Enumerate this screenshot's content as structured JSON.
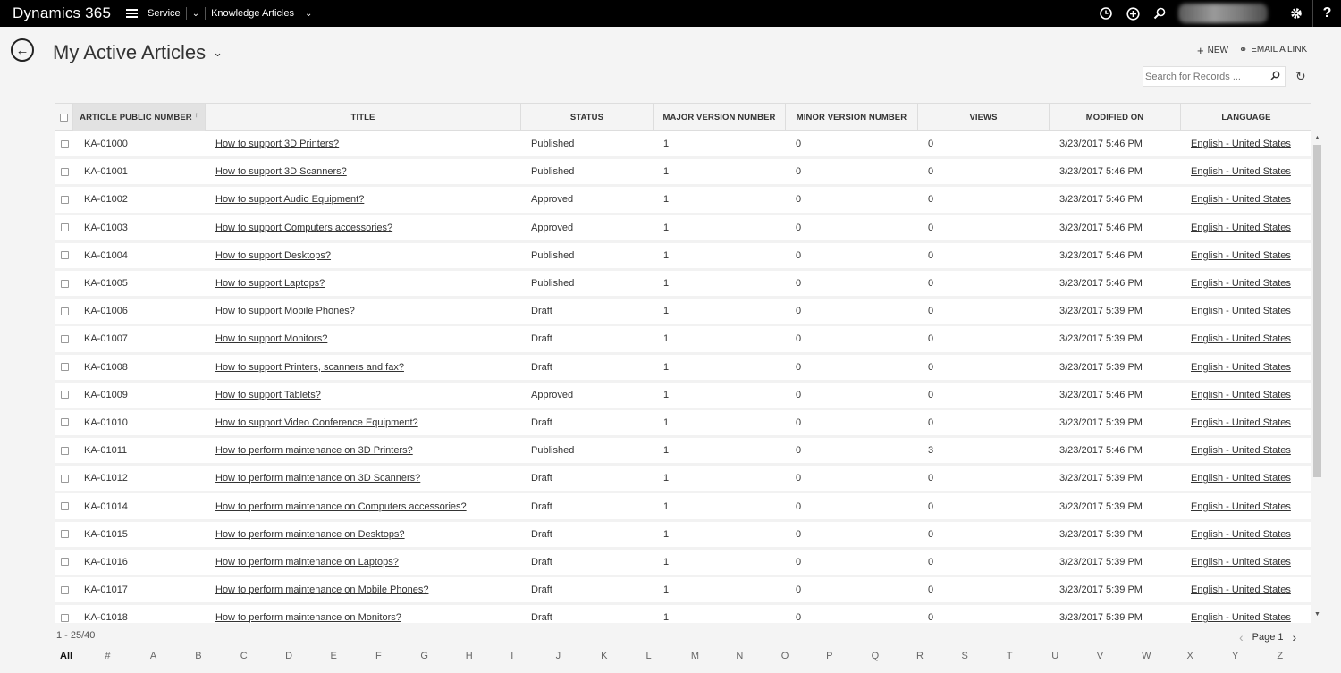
{
  "topbar": {
    "brand": "Dynamics 365",
    "nav": [
      {
        "label": "Service"
      },
      {
        "label": "Knowledge Articles"
      }
    ],
    "icons": [
      "clock-icon",
      "plus-circle-icon",
      "search-icon",
      "gear-icon",
      "help-icon"
    ],
    "help_label": "?"
  },
  "view": {
    "title": "My Active Articles"
  },
  "commands": {
    "new_label": "NEW",
    "email_label": "EMAIL A LINK"
  },
  "search": {
    "placeholder": "Search for Records ..."
  },
  "grid": {
    "columns": [
      "ARTICLE PUBLIC NUMBER",
      "TITLE",
      "STATUS",
      "MAJOR VERSION NUMBER",
      "MINOR VERSION NUMBER",
      "VIEWS",
      "MODIFIED ON",
      "LANGUAGE"
    ],
    "sort_indicator": "↑",
    "rows": [
      {
        "num": "KA-01000",
        "title": "How to support 3D Printers?",
        "status": "Published",
        "major": "1",
        "minor": "0",
        "views": "0",
        "modified": "3/23/2017 5:46 PM",
        "lang": "English - United States"
      },
      {
        "num": "KA-01001",
        "title": "How to support 3D Scanners?",
        "status": "Published",
        "major": "1",
        "minor": "0",
        "views": "0",
        "modified": "3/23/2017 5:46 PM",
        "lang": "English - United States"
      },
      {
        "num": "KA-01002",
        "title": "How to support Audio Equipment?",
        "status": "Approved",
        "major": "1",
        "minor": "0",
        "views": "0",
        "modified": "3/23/2017 5:46 PM",
        "lang": "English - United States"
      },
      {
        "num": "KA-01003",
        "title": "How to support Computers accessories?",
        "status": "Approved",
        "major": "1",
        "minor": "0",
        "views": "0",
        "modified": "3/23/2017 5:46 PM",
        "lang": "English - United States"
      },
      {
        "num": "KA-01004",
        "title": "How to support Desktops?",
        "status": "Published",
        "major": "1",
        "minor": "0",
        "views": "0",
        "modified": "3/23/2017 5:46 PM",
        "lang": "English - United States"
      },
      {
        "num": "KA-01005",
        "title": "How to support Laptops?",
        "status": "Published",
        "major": "1",
        "minor": "0",
        "views": "0",
        "modified": "3/23/2017 5:46 PM",
        "lang": "English - United States"
      },
      {
        "num": "KA-01006",
        "title": "How to support Mobile Phones?",
        "status": "Draft",
        "major": "1",
        "minor": "0",
        "views": "0",
        "modified": "3/23/2017 5:39 PM",
        "lang": "English - United States"
      },
      {
        "num": "KA-01007",
        "title": "How to support Monitors?",
        "status": "Draft",
        "major": "1",
        "minor": "0",
        "views": "0",
        "modified": "3/23/2017 5:39 PM",
        "lang": "English - United States"
      },
      {
        "num": "KA-01008",
        "title": "How to support Printers, scanners and fax?",
        "status": "Draft",
        "major": "1",
        "minor": "0",
        "views": "0",
        "modified": "3/23/2017 5:39 PM",
        "lang": "English - United States"
      },
      {
        "num": "KA-01009",
        "title": "How to support Tablets?",
        "status": "Approved",
        "major": "1",
        "minor": "0",
        "views": "0",
        "modified": "3/23/2017 5:46 PM",
        "lang": "English - United States"
      },
      {
        "num": "KA-01010",
        "title": "How to support Video Conference Equipment?",
        "status": "Draft",
        "major": "1",
        "minor": "0",
        "views": "0",
        "modified": "3/23/2017 5:39 PM",
        "lang": "English - United States"
      },
      {
        "num": "KA-01011",
        "title": "How to perform maintenance on 3D Printers?",
        "status": "Published",
        "major": "1",
        "minor": "0",
        "views": "3",
        "modified": "3/23/2017 5:46 PM",
        "lang": "English - United States"
      },
      {
        "num": "KA-01012",
        "title": "How to perform maintenance on 3D Scanners?",
        "status": "Draft",
        "major": "1",
        "minor": "0",
        "views": "0",
        "modified": "3/23/2017 5:39 PM",
        "lang": "English - United States"
      },
      {
        "num": "KA-01014",
        "title": "How to perform maintenance on Computers accessories?",
        "status": "Draft",
        "major": "1",
        "minor": "0",
        "views": "0",
        "modified": "3/23/2017 5:39 PM",
        "lang": "English - United States"
      },
      {
        "num": "KA-01015",
        "title": "How to perform maintenance on Desktops?",
        "status": "Draft",
        "major": "1",
        "minor": "0",
        "views": "0",
        "modified": "3/23/2017 5:39 PM",
        "lang": "English - United States"
      },
      {
        "num": "KA-01016",
        "title": "How to perform maintenance on Laptops?",
        "status": "Draft",
        "major": "1",
        "minor": "0",
        "views": "0",
        "modified": "3/23/2017 5:39 PM",
        "lang": "English - United States"
      },
      {
        "num": "KA-01017",
        "title": "How to perform maintenance on Mobile Phones?",
        "status": "Draft",
        "major": "1",
        "minor": "0",
        "views": "0",
        "modified": "3/23/2017 5:39 PM",
        "lang": "English - United States"
      },
      {
        "num": "KA-01018",
        "title": "How to perform maintenance on Monitors?",
        "status": "Draft",
        "major": "1",
        "minor": "0",
        "views": "0",
        "modified": "3/23/2017 5:39 PM",
        "lang": "English - United States"
      }
    ]
  },
  "footer": {
    "record_count": "1 - 25/40",
    "page_label": "Page 1",
    "alphabet": [
      "All",
      "#",
      "A",
      "B",
      "C",
      "D",
      "E",
      "F",
      "G",
      "H",
      "I",
      "J",
      "K",
      "L",
      "M",
      "N",
      "O",
      "P",
      "Q",
      "R",
      "S",
      "T",
      "U",
      "V",
      "W",
      "X",
      "Y",
      "Z"
    ],
    "active_letter": "All"
  }
}
